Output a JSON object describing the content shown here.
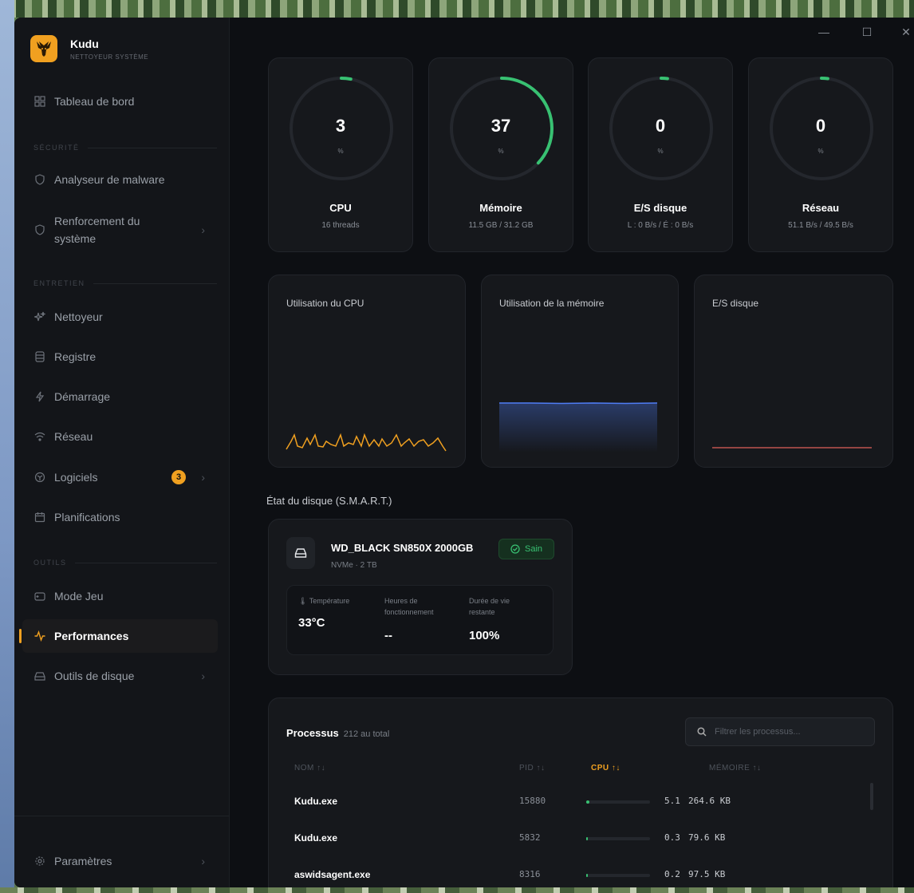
{
  "app": {
    "name": "Kudu",
    "subtitle": "NETTOYEUR SYSTÈME"
  },
  "window_controls": {
    "minimize": "—",
    "maximize": "☐",
    "close": "✕"
  },
  "sidebar": {
    "dashboard": "Tableau de bord",
    "sections": {
      "security": "SÉCURITÉ",
      "maintenance": "ENTRETIEN",
      "tools": "OUTILS"
    },
    "security_items": [
      {
        "label": "Analyseur de malware",
        "icon": "shield-icon"
      },
      {
        "label": "Renforcement du système",
        "line1": "Renforcement du",
        "line2": "système",
        "icon": "shield-icon"
      }
    ],
    "maintenance_items": [
      {
        "label": "Nettoyeur",
        "icon": "sparkle-icon"
      },
      {
        "label": "Registre",
        "icon": "database-icon"
      },
      {
        "label": "Démarrage",
        "icon": "bolt-icon"
      },
      {
        "label": "Réseau",
        "icon": "wifi-icon"
      },
      {
        "label": "Logiciels",
        "icon": "package-icon",
        "badge": "3"
      },
      {
        "label": "Planifications",
        "icon": "calendar-icon"
      }
    ],
    "tools_items": [
      {
        "label": "Mode Jeu",
        "icon": "gamepad-icon"
      },
      {
        "label": "Performances",
        "icon": "activity-icon",
        "active": true
      },
      {
        "label": "Outils de disque",
        "icon": "hard-drive-icon"
      }
    ],
    "settings": "Paramètres",
    "accent": "#f0a020"
  },
  "gauges": [
    {
      "value": "3",
      "unit": "%",
      "title": "CPU",
      "sub": "16 threads",
      "percent": 3
    },
    {
      "value": "37",
      "unit": "%",
      "title": "Mémoire",
      "sub": "11.5 GB / 31.2 GB",
      "percent": 37
    },
    {
      "value": "0",
      "unit": "%",
      "title": "E/S disque",
      "sub": "L : 0 B/s / É : 0 B/s",
      "percent": 0
    },
    {
      "value": "0",
      "unit": "%",
      "title": "Réseau",
      "sub": "51.1 B/s / 49.5 B/s",
      "percent": 0
    }
  ],
  "gauge_color": "#38c172",
  "charts": [
    {
      "title": "Utilisation du CPU",
      "color": "#f0a020"
    },
    {
      "title": "Utilisation de la mémoire",
      "color": "#4f7df5"
    },
    {
      "title": "E/S disque",
      "color": "#e0605a"
    }
  ],
  "disk_section": {
    "title": "État du disque (S.M.A.R.T.)",
    "name": "WD_BLACK SN850X 2000GB",
    "type": "NVMe · 2 TB",
    "status": "Sain",
    "temp_label": "Température",
    "temp_value": "33°C",
    "hours_label_1": "Heures de",
    "hours_label_2": "fonctionnement",
    "hours_value": "--",
    "life_label_1": "Durée de vie",
    "life_label_2": "restante",
    "life_value": "100%"
  },
  "processes": {
    "title": "Processus",
    "count": "212 au total",
    "search_placeholder": "Filtrer les processus...",
    "columns": {
      "name": "NOM ↑↓",
      "pid": "PID ↑↓",
      "cpu": "CPU ↑↓",
      "memory": "MÉMOIRE ↑↓"
    },
    "rows": [
      {
        "name": "Kudu.exe",
        "pid": "15880",
        "cpu": "5.1",
        "memory": "264.6 KB",
        "cpu_fraction": 0.05
      },
      {
        "name": "Kudu.exe",
        "pid": "5832",
        "cpu": "0.3",
        "memory": "79.6 KB",
        "cpu_fraction": 0.01
      },
      {
        "name": "aswidsagent.exe",
        "pid": "8316",
        "cpu": "0.2",
        "memory": "97.5 KB",
        "cpu_fraction": 0.01
      }
    ]
  }
}
